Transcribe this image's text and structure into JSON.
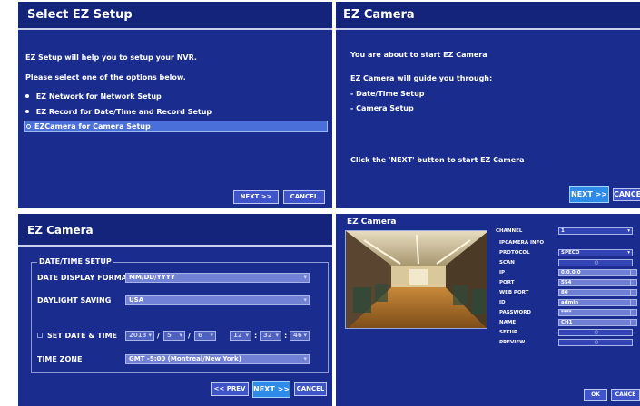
{
  "panel1": {
    "title": "Select EZ Setup",
    "line1": "EZ Setup will help you to setup your NVR.",
    "line2": "Please select one of the options below.",
    "options": [
      "EZ Network for Network Setup",
      "EZ Record for Date/Time and Record Setup",
      "EZCamera for Camera Setup"
    ],
    "next_label": "NEXT >>",
    "cancel_label": "CANCEL"
  },
  "panel2": {
    "title": "EZ Camera",
    "line1": "You are about to start EZ Camera",
    "line2": "EZ Camera will guide you through:",
    "item1": "- Date/Time Setup",
    "item2": "- Camera Setup",
    "line3": "Click the 'NEXT' button to start EZ Camera",
    "next_label": "NEXT >>",
    "cancel_label": "CANCE"
  },
  "panel3": {
    "title": "EZ Camera",
    "group_title": "DATE/TIME SETUP",
    "date_format_label": "DATE DISPLAY FORMAT",
    "date_format_value": "MM/DD/YYYY",
    "daylight_label": "DAYLIGHT SAVING",
    "daylight_value": "USA",
    "set_date_label": "SET DATE & TIME",
    "year": "2013",
    "month": "5",
    "day": "6",
    "hour": "12",
    "minute": "32",
    "second": "46",
    "sep_date": "/",
    "sep_time": ":",
    "timezone_label": "TIME ZONE",
    "timezone_value": "GMT -5:00 (Montreal/New York)",
    "prev_label": "<< PREV",
    "next_label": "NEXT >>",
    "cancel_label": "CANCEL"
  },
  "panel4": {
    "title": "EZ Camera",
    "channel_label": "CHANNEL",
    "channel_value": "1",
    "ipcamera_info": "IPCAMERA INFO",
    "protocol_label": "PROTOCOL",
    "protocol_value": "SPECO",
    "scan_label": "SCAN",
    "ip_label": "IP",
    "ip_value": "0.0.0.0",
    "port_label": "PORT",
    "port_value": "554",
    "webport_label": "WEB PORT",
    "webport_value": "80",
    "id_label": "ID",
    "id_value": "admin",
    "password_label": "PASSWORD",
    "password_value": "****",
    "name_label": "NAME",
    "name_value": "CH1",
    "setup_label": "SETUP",
    "preview_label": "PREVIEW",
    "ok_label": "OK",
    "cancel_label": "CANCE"
  },
  "colors": {
    "panel_bg": "#1a2d8f",
    "selected_row": "#4a6fd8",
    "button": "#3e54c8",
    "button_highlight": "#2f8be8"
  }
}
